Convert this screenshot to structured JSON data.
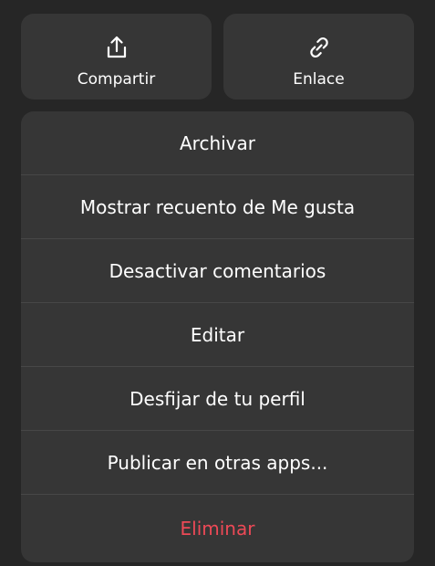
{
  "top_actions": {
    "share": {
      "label": "Compartir",
      "icon": "share-icon"
    },
    "link": {
      "label": "Enlace",
      "icon": "link-icon"
    }
  },
  "menu": {
    "items": [
      {
        "label": "Archivar"
      },
      {
        "label": "Mostrar recuento de Me gusta"
      },
      {
        "label": "Desactivar comentarios"
      },
      {
        "label": "Editar"
      },
      {
        "label": "Desfijar de tu perfil"
      },
      {
        "label": "Publicar en otras apps..."
      },
      {
        "label": "Eliminar"
      }
    ]
  },
  "colors": {
    "background": "#262626",
    "surface": "#363636",
    "divider": "#474747",
    "text": "#ffffff",
    "danger": "#ed4956"
  }
}
